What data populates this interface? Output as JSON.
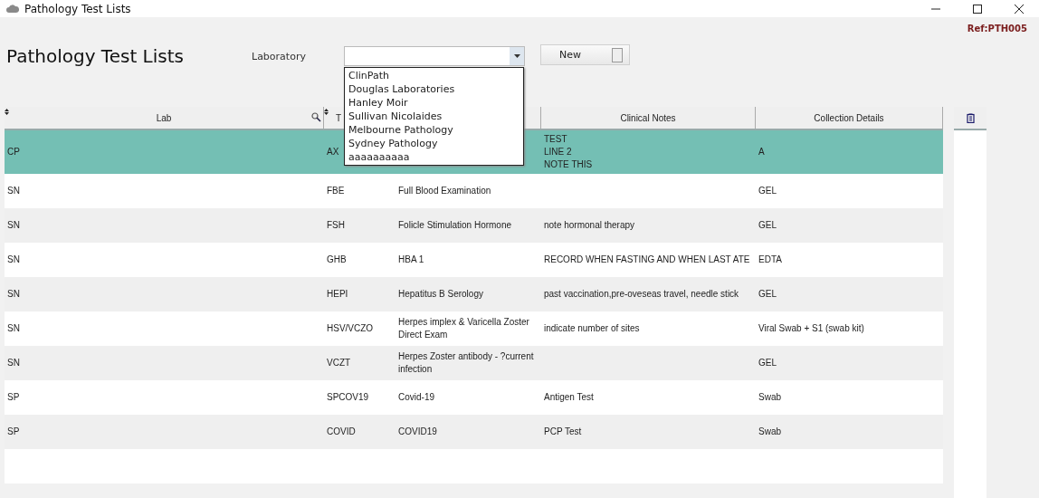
{
  "window": {
    "title": "Pathology Test Lists"
  },
  "ref": "Ref:PTH005",
  "heading": "Pathology Test Lists",
  "laboratory": {
    "label": "Laboratory",
    "options": [
      "ClinPath",
      "Douglas Laboratories",
      "Hanley Moir",
      "Sullivan Nicolaides",
      "Melbourne Pathology",
      "Sydney Pathology",
      "aaaaaaaaaa"
    ]
  },
  "new_button": "New",
  "table": {
    "columns": [
      {
        "label": "Lab",
        "sortable": true,
        "searchable": true
      },
      {
        "label": "T",
        "sortable": true,
        "searchable": false
      },
      {},
      {
        "label": "Clinical Notes",
        "sortable": false,
        "searchable": false
      },
      {
        "label": "Collection Details",
        "sortable": false,
        "searchable": false
      }
    ],
    "rows": [
      {
        "selected": true,
        "cells": [
          "CP",
          "AX",
          null,
          "TEST\nLINE 2\nNOTE THIS",
          "A"
        ]
      },
      {
        "selected": false,
        "cells": [
          "SN",
          "FBE",
          "Full Blood Examination",
          null,
          "GEL"
        ]
      },
      {
        "selected": false,
        "cells": [
          "SN",
          "FSH",
          "Folicle Stimulation Hormone",
          "note hormonal therapy",
          "GEL"
        ]
      },
      {
        "selected": false,
        "cells": [
          "SN",
          "GHB",
          "HBA 1",
          "RECORD WHEN FASTING AND WHEN LAST ATE",
          "EDTA"
        ]
      },
      {
        "selected": false,
        "cells": [
          "SN",
          "HEPI",
          "Hepatitus B Serology",
          "past vaccination,pre-oveseas travel, needle stick",
          "GEL"
        ]
      },
      {
        "selected": false,
        "cells": [
          "SN",
          "HSV/VCZO",
          "Herpes implex & Varicella Zoster Direct Exam",
          "indicate number of sites",
          "Viral Swab + S1 (swab kit)"
        ]
      },
      {
        "selected": false,
        "cells": [
          "SN",
          "VCZT",
          "Herpes Zoster antibody - ?current infection",
          null,
          "GEL"
        ]
      },
      {
        "selected": false,
        "cells": [
          "SP",
          "SPCOV19",
          "Covid-19",
          "Antigen Test",
          "Swab"
        ]
      },
      {
        "selected": false,
        "cells": [
          "SP",
          "COVID",
          "COVID19",
          "PCP Test",
          "Swab"
        ]
      },
      {
        "selected": false,
        "cells": [
          null,
          null,
          null,
          null,
          null
        ]
      }
    ]
  }
}
